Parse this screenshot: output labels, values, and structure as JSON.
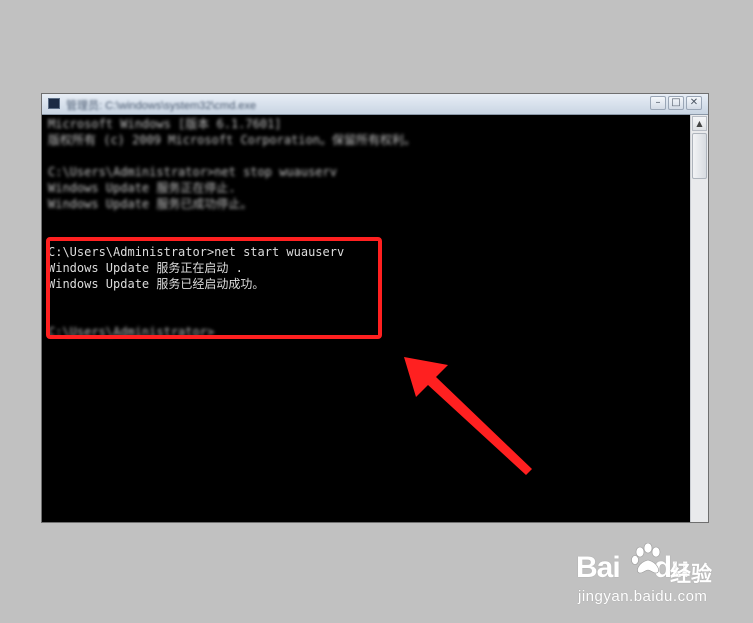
{
  "window": {
    "title": "管理员: C:\\windows\\system32\\cmd.exe",
    "minimize_glyph": "–",
    "maximize_glyph": "□",
    "close_glyph": "✕"
  },
  "console": {
    "blurred_lines": [
      "Microsoft Windows [版本 6.1.7601]",
      "版权所有 (c) 2009 Microsoft Corporation。保留所有权利。",
      "",
      "C:\\Users\\Administrator>net stop wuauserv",
      "Windows Update 服务正在停止.",
      "Windows Update 服务已成功停止。"
    ],
    "highlighted_lines": [
      "C:\\Users\\Administrator>net start wuauserv",
      "Windows Update 服务正在启动 .",
      "Windows Update 服务已经启动成功。"
    ],
    "trailing_prompt": "C:\\Users\\Administrator>"
  },
  "watermark": {
    "logo_text": "Bai",
    "logo_text_2": "du",
    "cn_text": "经验",
    "url": "jingyan.baidu.com"
  },
  "colors": {
    "highlight": "#ff2020",
    "arrow": "#ff2020",
    "console_bg": "#000000",
    "page_bg": "#c1c1c1"
  }
}
